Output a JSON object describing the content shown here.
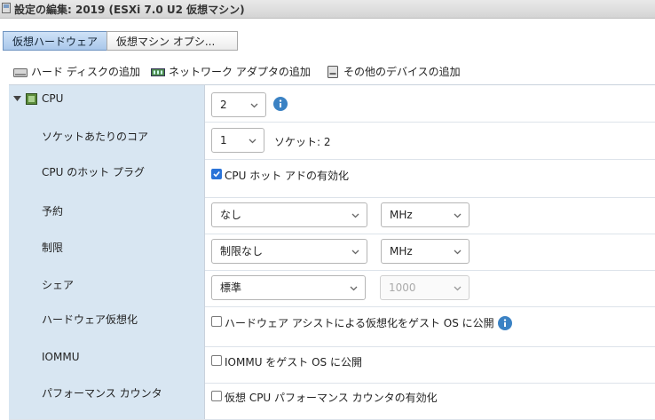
{
  "window": {
    "title": "設定の編集: 2019 (ESXi 7.0 U2 仮想マシン)"
  },
  "tabs": [
    {
      "label": "仮想ハードウェア",
      "active": true
    },
    {
      "label": "仮想マシン オプシ..."
    }
  ],
  "toolbar": {
    "add_disk": "ハード ディスクの追加",
    "add_nic": "ネットワーク アダプタの追加",
    "add_other": "その他のデバイスの追加"
  },
  "cpu": {
    "label": "CPU",
    "count": "2",
    "cores_label": "ソケットあたりのコア",
    "cores": "1",
    "sockets": "ソケット: 2",
    "hotplug_label": "CPU のホット プラグ",
    "hotplug_text": "CPU ホット アドの有効化",
    "hotplug_checked": true,
    "reservation_label": "予約",
    "reservation": "なし",
    "reservation_unit": "MHz",
    "limit_label": "制限",
    "limit": "制限なし",
    "limit_unit": "MHz",
    "shares_label": "シェア",
    "shares": "標準",
    "shares_value": "1000",
    "hv_label": "ハードウェア仮想化",
    "hv_text": "ハードウェア アシストによる仮想化をゲスト OS に公開",
    "iommu_label": "IOMMU",
    "iommu_text": "IOMMU をゲスト OS に公開",
    "perf_label": "パフォーマンス カウンタ",
    "perf_text": "仮想 CPU パフォーマンス カウンタの有効化"
  },
  "colors": {
    "label_bg": "#d8e6f2",
    "accent": "#2a73d8",
    "info": "#3b82c4"
  }
}
